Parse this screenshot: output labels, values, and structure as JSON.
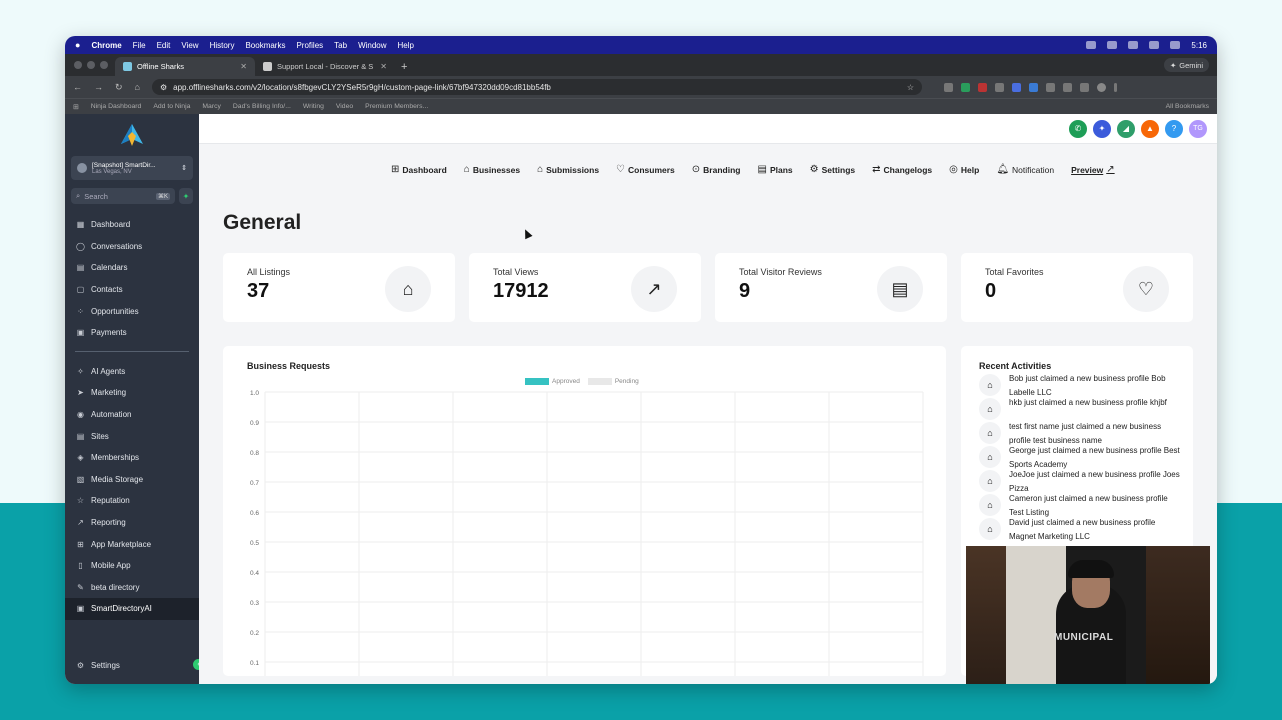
{
  "menubar": {
    "app": "Chrome",
    "items": [
      "File",
      "Edit",
      "View",
      "History",
      "Bookmarks",
      "Profiles",
      "Tab",
      "Window",
      "Help"
    ],
    "clock": "5:16"
  },
  "tabs": [
    {
      "title": "Offline Sharks"
    },
    {
      "title": "Support Local - Discover & S"
    }
  ],
  "gemini": "Gemini",
  "address": {
    "url": "app.offlinesharks.com/v2/location/s8fbgevCLY2YSeR5r9gH/custom-page-link/67bf947320dd09cd81bb54fb"
  },
  "bookmarks": [
    "Ninja Dashboard",
    "Add to Ninja",
    "Marcy",
    "Dad's Billing Info/...",
    "Writing",
    "Video",
    "Premium Members..."
  ],
  "all_bookmarks": "All Bookmarks",
  "sidebar": {
    "location_name": "[Snapshot] SmartDir...",
    "location_city": "Las Vegas, NV",
    "search_placeholder": "Search",
    "search_shortcut": "⌘K",
    "items_top": [
      {
        "label": "Dashboard",
        "icon": "▦"
      },
      {
        "label": "Conversations",
        "icon": "◯"
      },
      {
        "label": "Calendars",
        "icon": "▤"
      },
      {
        "label": "Contacts",
        "icon": "▢"
      },
      {
        "label": "Opportunities",
        "icon": "⁘"
      },
      {
        "label": "Payments",
        "icon": "▣"
      }
    ],
    "items_bottom": [
      {
        "label": "AI Agents",
        "icon": "✧"
      },
      {
        "label": "Marketing",
        "icon": "➤"
      },
      {
        "label": "Automation",
        "icon": "◉"
      },
      {
        "label": "Sites",
        "icon": "▤"
      },
      {
        "label": "Memberships",
        "icon": "◈"
      },
      {
        "label": "Media Storage",
        "icon": "▧"
      },
      {
        "label": "Reputation",
        "icon": "☆"
      },
      {
        "label": "Reporting",
        "icon": "↗"
      },
      {
        "label": "App Marketplace",
        "icon": "⊞"
      },
      {
        "label": "Mobile App",
        "icon": "▯"
      },
      {
        "label": "beta directory",
        "icon": "✎"
      },
      {
        "label": "SmartDirectoryAI",
        "icon": "▣"
      }
    ],
    "settings": "Settings"
  },
  "topstrip_avatar": "TG",
  "topnav": [
    {
      "label": "Dashboard",
      "icon": "⊞"
    },
    {
      "label": "Businesses",
      "icon": "⌂"
    },
    {
      "label": "Submissions",
      "icon": "⌂"
    },
    {
      "label": "Consumers",
      "icon": "♡"
    },
    {
      "label": "Branding",
      "icon": "⊙"
    },
    {
      "label": "Plans",
      "icon": "▤"
    },
    {
      "label": "Settings",
      "icon": "⚙"
    },
    {
      "label": "Changelogs",
      "icon": "⇄"
    },
    {
      "label": "Help",
      "icon": "◎"
    }
  ],
  "notification": "Notification",
  "preview": "Preview",
  "page_title": "General",
  "stats": [
    {
      "label": "All Listings",
      "value": "37",
      "icon": "⌂"
    },
    {
      "label": "Total Views",
      "value": "17912",
      "icon": "↗"
    },
    {
      "label": "Total Visitor Reviews",
      "value": "9",
      "icon": "▤"
    },
    {
      "label": "Total Favorites",
      "value": "0",
      "icon": "♡"
    }
  ],
  "chart_data": {
    "type": "bar",
    "title": "Business Requests",
    "categories": [],
    "series": [
      {
        "name": "Approved",
        "color": "#36c2c2",
        "values": []
      },
      {
        "name": "Pending",
        "color": "#e8e8e8",
        "values": []
      }
    ],
    "yticks": [
      "1.0",
      "0.9",
      "0.8",
      "0.7",
      "0.6",
      "0.5",
      "0.4",
      "0.3",
      "0.2",
      "0.1"
    ],
    "ylim": [
      0,
      1.0
    ],
    "grid": true,
    "legend": "top-center"
  },
  "activities_title": "Recent Activities",
  "activities": [
    "Bob just claimed a new business profile Bob Labelle LLC",
    "hkb just claimed a new business profile khjbf",
    "test first name just claimed a new business profile test business name",
    "George just claimed a new business profile Best Sports Academy",
    "JoeJoe just claimed a new business profile Joes Pizza",
    "Cameron just claimed a new business profile Test Listing",
    "David just claimed a new business profile Magnet Marketing LLC"
  ],
  "webcam_shirt": "MUNICIPAL"
}
